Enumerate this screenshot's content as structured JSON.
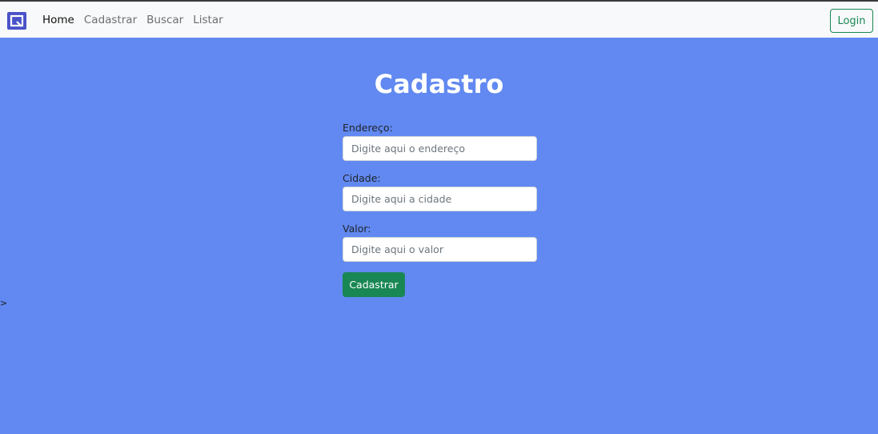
{
  "navbar": {
    "logo_icon": "brand-logo-icon",
    "links": [
      {
        "label": "Home",
        "active": true
      },
      {
        "label": "Cadastrar",
        "active": false
      },
      {
        "label": "Buscar",
        "active": false
      },
      {
        "label": "Listar",
        "active": false
      }
    ],
    "login_label": "Login"
  },
  "main": {
    "title": "Cadastro",
    "fields": [
      {
        "label": "Endereço:",
        "placeholder": "Digite aqui o endereço",
        "value": ""
      },
      {
        "label": "Cidade:",
        "placeholder": "Digite aqui a cidade",
        "value": ""
      },
      {
        "label": "Valor:",
        "placeholder": "Digite aqui o valor",
        "value": ""
      }
    ],
    "submit_label": "Cadastrar",
    "stray_text": ">"
  },
  "colors": {
    "background": "#6189f1",
    "navbar": "#f8f9fa",
    "success": "#198754",
    "brand": "#4a52c8"
  }
}
